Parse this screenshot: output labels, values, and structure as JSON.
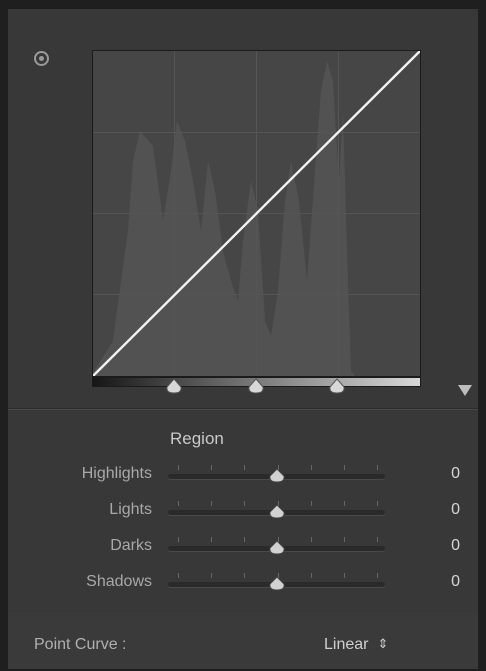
{
  "curve": {
    "points": [
      [
        0,
        0
      ],
      [
        255,
        255
      ]
    ],
    "channel_range": [
      0,
      255
    ],
    "split_points": [
      25,
      50,
      75
    ]
  },
  "region": {
    "title": "Region",
    "sliders": [
      {
        "label": "Highlights",
        "value": "0"
      },
      {
        "label": "Lights",
        "value": "0"
      },
      {
        "label": "Darks",
        "value": "0"
      },
      {
        "label": "Shadows",
        "value": "0"
      }
    ]
  },
  "point_curve": {
    "label": "Point Curve :",
    "value": "Linear"
  },
  "icons": {
    "target_adjust": "target-adjust-icon",
    "panel_menu": "triangle-down-icon",
    "select_stepper": "up-down-stepper-icon"
  },
  "colors": {
    "panel_bg": "#383838",
    "graph_bg": "#464646",
    "curve_line": "#f2f2f2"
  }
}
